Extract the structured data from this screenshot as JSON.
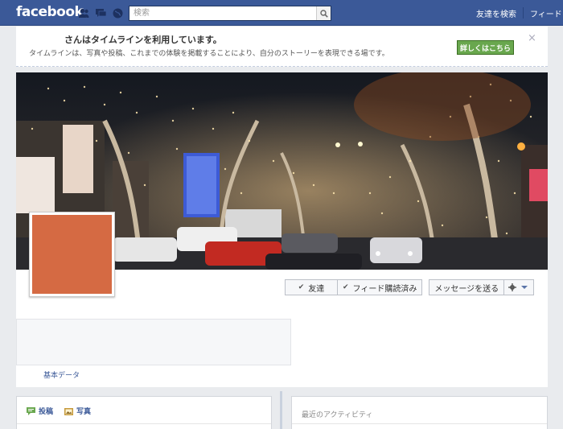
{
  "topbar": {
    "logo": "facebook",
    "search_placeholder": "検索",
    "links": [
      "友達を検索",
      "フィード"
    ]
  },
  "banner": {
    "title": "さんはタイムラインを利用しています。",
    "description": "タイムラインは、写真や投稿、これまでの体験を掲載することにより、自分のストーリーを表現できる場です。",
    "button_label": "詳しくはこちら",
    "close_label": "×"
  },
  "profile": {
    "picture_color": "#d56a43",
    "friend_button": "友達",
    "feed_button": "フィード購読済み",
    "message_button": "メッセージを送る",
    "basic_info_link": "基本データ"
  },
  "composer": {
    "tab_post": "投稿",
    "tab_photo": "写真"
  },
  "activity": {
    "title": "最近のアクティビティ"
  },
  "colors": {
    "brand": "#3b5998",
    "accent_green": "#69a74e"
  }
}
